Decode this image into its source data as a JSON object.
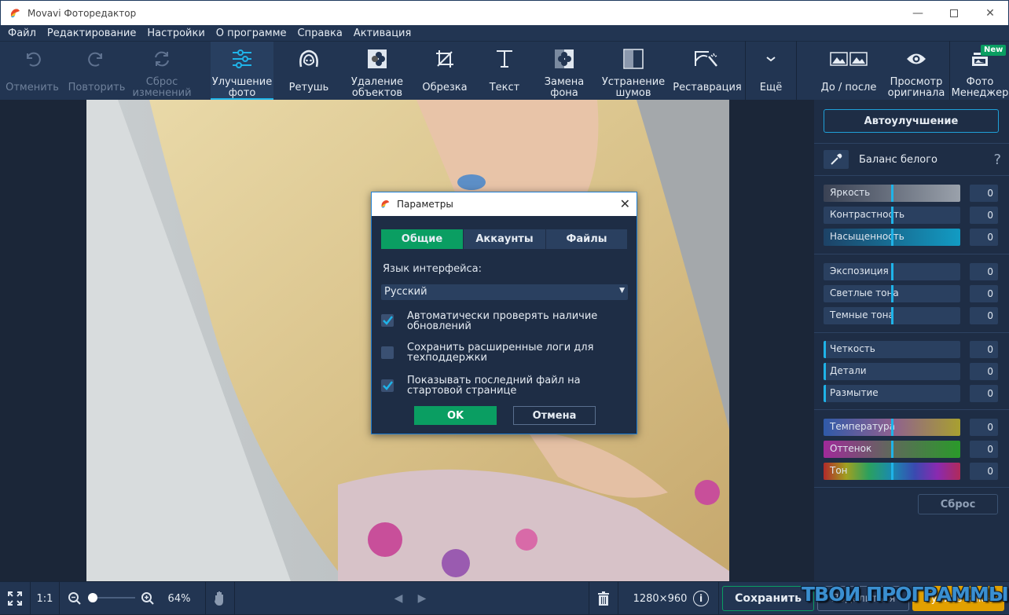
{
  "window": {
    "title": "Movavi Фоторедактор",
    "minimize_icon": "minimize-icon",
    "maximize_icon": "maximize-icon",
    "close_icon": "close-icon"
  },
  "menu": [
    "Файл",
    "Редактирование",
    "Настройки",
    "О программе",
    "Справка",
    "Активация"
  ],
  "toolbar": {
    "items": [
      {
        "label": "Отменить",
        "icon": "undo-icon",
        "enabled": false
      },
      {
        "label": "Повторить",
        "icon": "redo-icon",
        "enabled": false
      },
      {
        "label": "Сброс\nизменений",
        "icon": "reset-icon",
        "enabled": false
      },
      {
        "label": "Улучшение\nфото",
        "icon": "sliders-icon",
        "enabled": true,
        "active": true
      },
      {
        "label": "Ретушь",
        "icon": "face-icon",
        "enabled": true
      },
      {
        "label": "Удаление\nобъектов",
        "icon": "object-removal-icon",
        "enabled": true
      },
      {
        "label": "Обрезка",
        "icon": "crop-icon",
        "enabled": true
      },
      {
        "label": "Текст",
        "icon": "text-icon",
        "enabled": true
      },
      {
        "label": "Замена\nфона",
        "icon": "background-replace-icon",
        "enabled": true
      },
      {
        "label": "Устранение\nшумов",
        "icon": "denoise-icon",
        "enabled": true
      },
      {
        "label": "Реставрация",
        "icon": "restoration-icon",
        "enabled": true
      },
      {
        "label": "Ещё",
        "icon": "chevron-down-icon",
        "enabled": true
      }
    ],
    "right_items": [
      {
        "label": "До / после",
        "icon": "before-after-icon"
      },
      {
        "label": "Просмотр\nоригинала",
        "icon": "eye-icon"
      },
      {
        "label": "Фото\nМенеджер",
        "icon": "photo-manager-icon",
        "badge": "New"
      }
    ]
  },
  "right_panel": {
    "auto_enhance": "Автоулучшение",
    "white_balance": "Баланс белого",
    "help": "?",
    "groups": [
      [
        {
          "label": "Яркость",
          "value": "0",
          "position": 0.5
        },
        {
          "label": "Контрастность",
          "value": "0",
          "position": 0.5
        },
        {
          "label": "Насыщенность",
          "value": "0",
          "position": 0.5
        }
      ],
      [
        {
          "label": "Экспозиция",
          "value": "0",
          "position": 0.5
        },
        {
          "label": "Светлые тона",
          "value": "0",
          "position": 0.5
        },
        {
          "label": "Темные тона",
          "value": "0",
          "position": 0.5
        }
      ],
      [
        {
          "label": "Четкость",
          "value": "0",
          "position": 0
        },
        {
          "label": "Детали",
          "value": "0",
          "position": 0
        },
        {
          "label": "Размытие",
          "value": "0",
          "position": 0
        }
      ],
      [
        {
          "label": "Температура",
          "value": "0",
          "position": 0.5
        },
        {
          "label": "Оттенок",
          "value": "0",
          "position": 0.5
        },
        {
          "label": "Тон",
          "value": "0",
          "position": 0.5
        }
      ]
    ],
    "reset": "Сброс"
  },
  "dialog": {
    "title": "Параметры",
    "tabs": [
      {
        "label": "Общие",
        "active": true
      },
      {
        "label": "Аккаунты",
        "active": false
      },
      {
        "label": "Файлы",
        "active": false
      }
    ],
    "language_label": "Язык интерфейса:",
    "language_value": "Русский",
    "options": [
      {
        "label": "Автоматически проверять наличие обновлений",
        "checked": true
      },
      {
        "label": "Сохранить расширенные логи для техподдержки",
        "checked": false
      },
      {
        "label": "Показывать последний файл на стартовой странице",
        "checked": true
      }
    ],
    "ok": "OK",
    "cancel": "Отмена"
  },
  "bottom": {
    "ratio": "1:1",
    "zoom": "64%",
    "zoom_fraction": 0.08,
    "dimensions": "1280×960",
    "save": "Сохранить",
    "share": "Поделиться",
    "buy": "Купить ключ"
  },
  "colors": {
    "accent": "#1fb3e8",
    "green": "#0a9e62",
    "orange": "#e2a000",
    "panel": "#1e2d45",
    "toolbar": "#223552"
  },
  "watermark": "ТВОИ ПРОГРАММЫ.РУ"
}
